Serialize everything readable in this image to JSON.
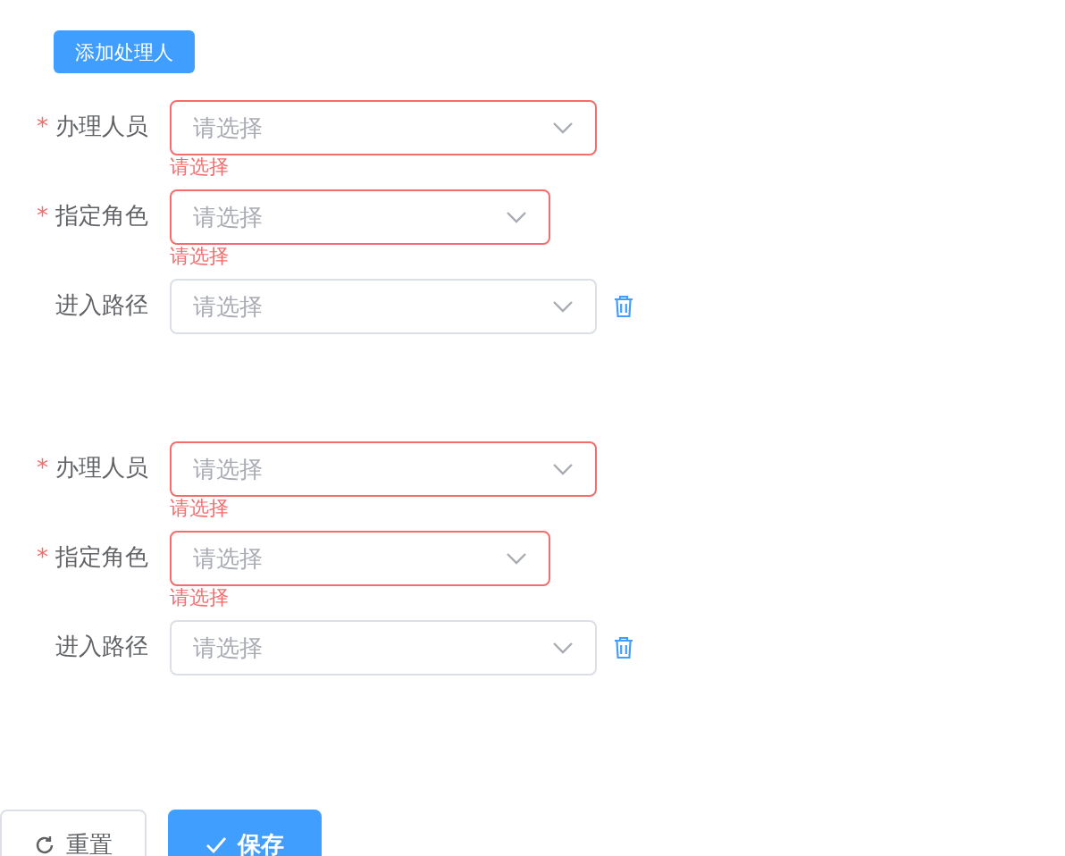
{
  "add_button": "添加处理人",
  "groups": [
    {
      "fields": [
        {
          "label": "办理人员",
          "required_mark": "*",
          "placeholder": "请选择",
          "error": "请选择",
          "removable": false
        },
        {
          "label": "指定角色",
          "required_mark": "*",
          "placeholder": "请选择",
          "error": "请选择",
          "removable": false
        },
        {
          "label": "进入路径",
          "placeholder": "请选择",
          "removable": true
        }
      ]
    },
    {
      "fields": [
        {
          "label": "办理人员",
          "required_mark": "*",
          "placeholder": "请选择",
          "error": "请选择",
          "removable": false
        },
        {
          "label": "指定角色",
          "required_mark": "*",
          "placeholder": "请选择",
          "error": "请选择",
          "removable": false
        },
        {
          "label": "进入路径",
          "placeholder": "请选择",
          "removable": true
        }
      ]
    }
  ],
  "actions": [
    {
      "kind": "reset",
      "label": "重置"
    },
    {
      "kind": "save",
      "label": "保存"
    }
  ]
}
